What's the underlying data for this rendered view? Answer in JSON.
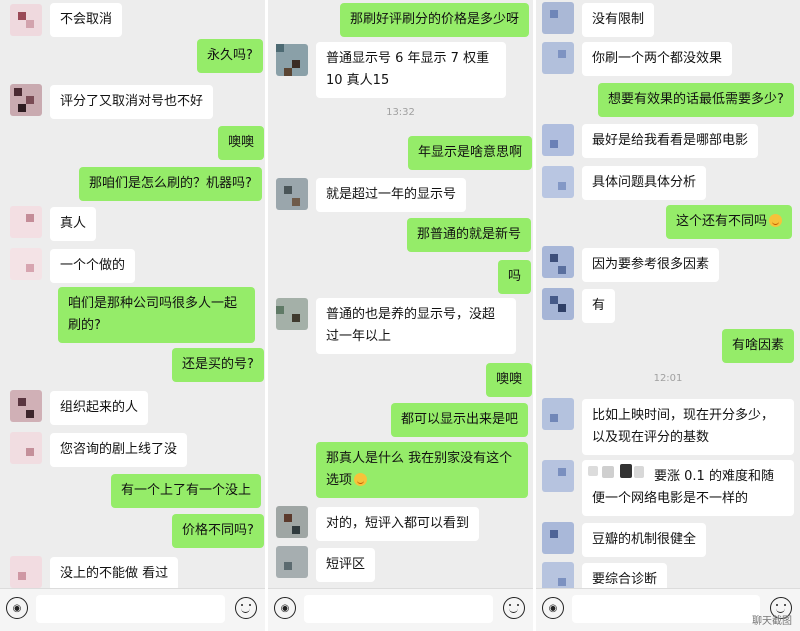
{
  "left_panel": {
    "messages": [
      {
        "side": "in",
        "text": "不会取消"
      },
      {
        "side": "out",
        "text": "永久吗?"
      },
      {
        "side": "in",
        "text": "评分了又取消对号也不好"
      },
      {
        "side": "out",
        "text": "噢噢"
      },
      {
        "side": "out",
        "text": "那咱们是怎么刷的？机器吗?"
      },
      {
        "side": "in",
        "text": "真人"
      },
      {
        "side": "in",
        "text": "一个个做的"
      },
      {
        "side": "out",
        "text": "咱们是那种公司吗很多人一起刷的?"
      },
      {
        "side": "out",
        "text": "还是买的号?"
      },
      {
        "side": "in",
        "text": "组织起来的人"
      },
      {
        "side": "in",
        "text": "您咨询的剧上线了没"
      },
      {
        "side": "out",
        "text": "有一个上了有一个没上"
      },
      {
        "side": "out",
        "text": "价格不同吗?"
      },
      {
        "side": "in",
        "text": "没上的不能做 看过"
      }
    ]
  },
  "middle_panel": {
    "messages": [
      {
        "side": "out",
        "text": "那刷好评刷分的价格是多少呀"
      },
      {
        "side": "in",
        "text": "普通显示号 6 年显示 7 权重 10 真人15"
      },
      {
        "side": "out",
        "text": "年显示是啥意思啊"
      },
      {
        "side": "in",
        "text": "就是超过一年的显示号"
      },
      {
        "side": "out",
        "text": "那普通的就是新号"
      },
      {
        "side": "out",
        "text": "吗"
      },
      {
        "side": "in",
        "text": "普通的也是养的显示号，没超过一年以上"
      },
      {
        "side": "out",
        "text": "噢噢"
      },
      {
        "side": "out",
        "text": "都可以显示出来是吧"
      },
      {
        "side": "out",
        "text": "那真人是什么 我在别家没有这个选项"
      },
      {
        "side": "in",
        "text": "对的，短评入都可以看到"
      },
      {
        "side": "in",
        "text": "短评区"
      }
    ],
    "time": "13:32"
  },
  "right_panel": {
    "messages": [
      {
        "side": "in",
        "text": "没有限制"
      },
      {
        "side": "in",
        "text": "你刷一个两个都没效果"
      },
      {
        "side": "out",
        "text": "想要有效果的话最低需要多少?"
      },
      {
        "side": "in",
        "text": "最好是给我看看是哪部电影"
      },
      {
        "side": "in",
        "text": "具体问题具体分析"
      },
      {
        "side": "out",
        "text": "这个还有不同吗"
      },
      {
        "side": "in",
        "text": "因为要参考很多因素"
      },
      {
        "side": "in",
        "text": "有"
      },
      {
        "side": "out",
        "text": "有啥因素"
      },
      {
        "side": "in",
        "text": "比如上映时间，现在开分多少，以及现在评分的基数"
      },
      {
        "side": "in",
        "text": "要涨 0.1 的难度和随便一个网络电影是不一样的"
      },
      {
        "side": "in",
        "text": "豆瓣的机制很健全"
      },
      {
        "side": "in",
        "text": "要综合诊断"
      }
    ],
    "time": "12:01"
  },
  "watermark": "聊天截图",
  "icons": [
    "voice-icon",
    "emoji-icon"
  ]
}
